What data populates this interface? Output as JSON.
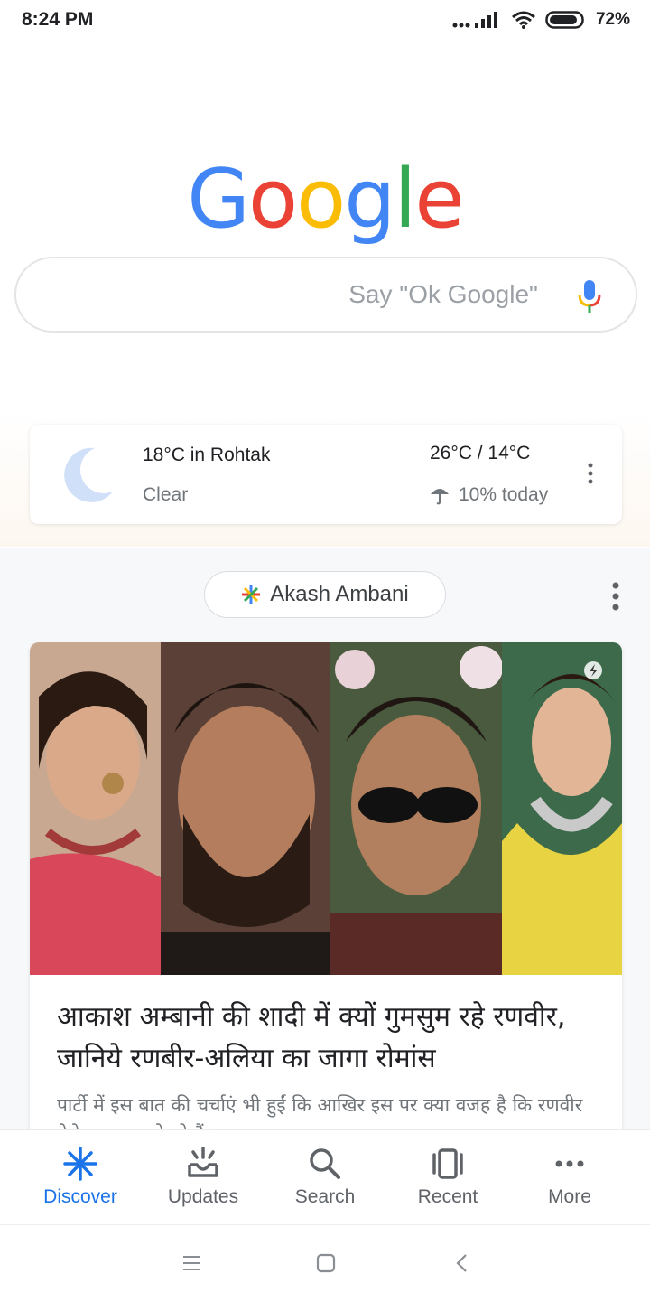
{
  "status": {
    "time": "8:24 PM",
    "battery": "72%"
  },
  "logo": {
    "letters": [
      "G",
      "o",
      "o",
      "g",
      "l",
      "e"
    ],
    "colors": [
      "#4285F4",
      "#EA4335",
      "#FBBC05",
      "#4285F4",
      "#34A853",
      "#EA4335"
    ]
  },
  "search": {
    "placeholder": "Say \"Ok Google\""
  },
  "weather": {
    "location": "18°C in Rohtak",
    "condition": "Clear",
    "high_low": "26°C / 14°C",
    "rain": "10% today"
  },
  "topic_chip": {
    "label": "Akash Ambani"
  },
  "card": {
    "headline": "आकाश अम्बानी की शादी में क्यों गुमसुम रहे रणवीर, जानिये रणबीर-अलिया का जागा रोमांस",
    "snippet": "पार्टी में इस बात की चर्चाएं भी हुईं कि आखिर इस पर क्या वजह है कि रणवीर ऐसे चुपचाप बने रहे हैं।"
  },
  "nav": {
    "items": [
      {
        "label": "Discover",
        "icon": "discover-icon"
      },
      {
        "label": "Updates",
        "icon": "updates-icon"
      },
      {
        "label": "Search",
        "icon": "search-icon"
      },
      {
        "label": "Recent",
        "icon": "recent-icon"
      },
      {
        "label": "More",
        "icon": "more-icon"
      }
    ],
    "active_color": "#1a73e8"
  }
}
